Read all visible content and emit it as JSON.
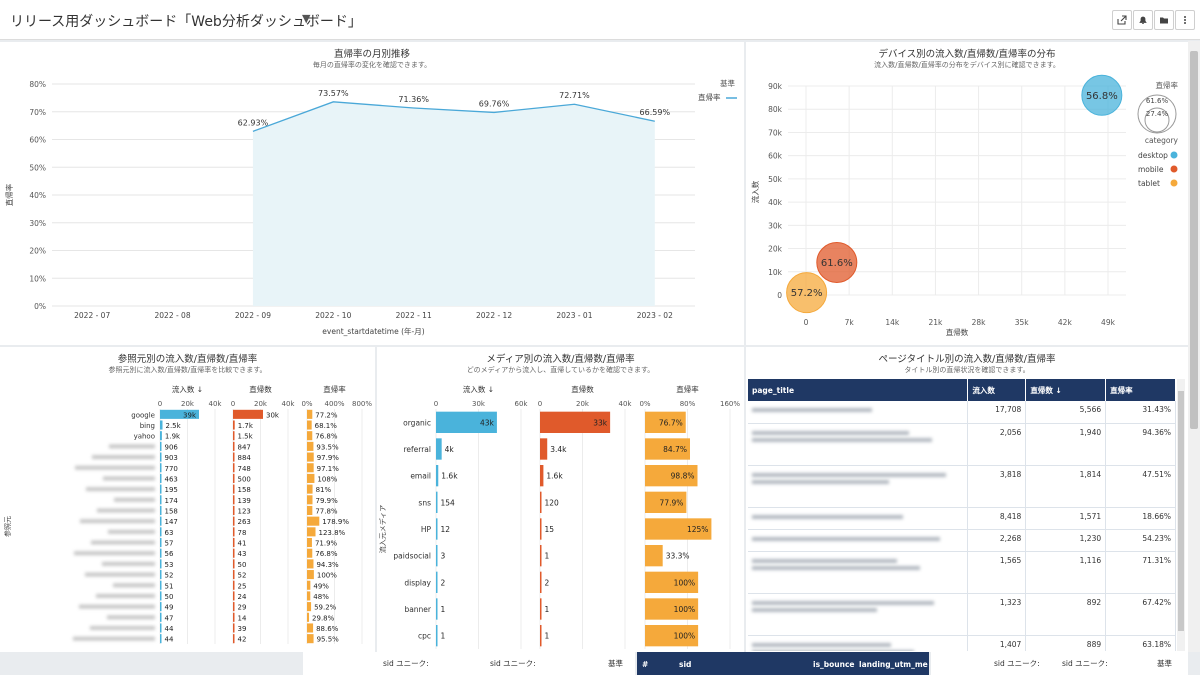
{
  "header": {
    "title": "リリース用ダッシュボード「Web分析ダッシュボード」",
    "caret": "▼",
    "icons": [
      "share-icon",
      "bell-icon",
      "folder-icon",
      "more-icon"
    ]
  },
  "p1": {
    "title": "直帰率の月別推移",
    "subtitle": "毎月の直帰率の変化を確認できます。",
    "ylabel": "直帰率",
    "xlabel": "event_startdatetime (年-月)",
    "legend_title": "基準",
    "legend_item": "直帰率",
    "chart_data": {
      "type": "area",
      "categories": [
        "2022 - 07",
        "2022 - 08",
        "2022 - 09",
        "2022 - 10",
        "2022 - 11",
        "2022 - 12",
        "2023 - 01",
        "2023 - 02"
      ],
      "values": [
        null,
        null,
        62.93,
        73.57,
        71.36,
        69.76,
        72.71,
        66.59
      ],
      "labels": [
        "",
        "",
        "62.93%",
        "73.57%",
        "71.36%",
        "69.76%",
        "72.71%",
        "66.59%"
      ],
      "yticks": [
        "80%",
        "70%",
        "60%",
        "50%",
        "40%",
        "30%",
        "20%",
        "10%",
        "0%"
      ],
      "ylim": [
        0,
        80
      ],
      "color": "#4aa8d8"
    }
  },
  "p2": {
    "title": "デバイス別の流入数/直帰数/直帰率の分布",
    "subtitle": "流入数/直帰数/直帰率の分布をデバイス別に確認できます。",
    "xlabel": "直帰数",
    "ylabel": "流入数",
    "size_legend_title": "直帰率",
    "size_legend": [
      "61.6%",
      "27.4%"
    ],
    "category_title": "category",
    "chart_data": {
      "type": "scatter",
      "xticks": [
        "0",
        "7k",
        "14k",
        "21k",
        "28k",
        "35k",
        "42k",
        "49k"
      ],
      "yticks": [
        "90k",
        "80k",
        "70k",
        "60k",
        "50k",
        "40k",
        "30k",
        "20k",
        "10k",
        "0"
      ],
      "xlim": [
        0,
        49000
      ],
      "ylim": [
        0,
        90000
      ],
      "series": [
        {
          "name": "desktop",
          "x": 48000,
          "y": 86000,
          "rate": "56.8%",
          "color": "#4ab3db"
        },
        {
          "name": "mobile",
          "x": 5000,
          "y": 14000,
          "rate": "61.6%",
          "color": "#e05a2b"
        },
        {
          "name": "tablet",
          "x": 100,
          "y": 1000,
          "rate": "57.2%",
          "color": "#f5a93b"
        }
      ]
    }
  },
  "p3": {
    "title": "参照元別の流入数/直帰数/直帰率",
    "subtitle": "参照元別に流入数/直帰数/直帰率を比較できます。",
    "ylabel": "参照元",
    "col_headers": [
      "流入数 ↓",
      "直帰数",
      "直帰率"
    ],
    "axes": [
      [
        "0",
        "20k",
        "40k"
      ],
      [
        "0",
        "20k",
        "40k"
      ],
      [
        "0%",
        "400%",
        "800%"
      ]
    ],
    "rows": [
      {
        "src": "google",
        "in": 39000,
        "in_l": "39k",
        "b": 30000,
        "b_l": "30k",
        "r": 77.2,
        "r_l": "77.2%"
      },
      {
        "src": "bing",
        "in": 2500,
        "in_l": "2.5k",
        "b": 1700,
        "b_l": "1.7k",
        "r": 68.1,
        "r_l": "68.1%"
      },
      {
        "src": "yahoo",
        "in": 1900,
        "in_l": "1.9k",
        "b": 1500,
        "b_l": "1.5k",
        "r": 76.8,
        "r_l": "76.8%"
      },
      {
        "src": "",
        "in": 906,
        "in_l": "906",
        "b": 847,
        "b_l": "847",
        "r": 93.5,
        "r_l": "93.5%"
      },
      {
        "src": "",
        "in": 903,
        "in_l": "903",
        "b": 884,
        "b_l": "884",
        "r": 97.9,
        "r_l": "97.9%"
      },
      {
        "src": "",
        "in": 770,
        "in_l": "770",
        "b": 748,
        "b_l": "748",
        "r": 97.1,
        "r_l": "97.1%"
      },
      {
        "src": "",
        "in": 463,
        "in_l": "463",
        "b": 500,
        "b_l": "500",
        "r": 108,
        "r_l": "108%"
      },
      {
        "src": "",
        "in": 195,
        "in_l": "195",
        "b": 158,
        "b_l": "158",
        "r": 81,
        "r_l": "81%"
      },
      {
        "src": "",
        "in": 174,
        "in_l": "174",
        "b": 139,
        "b_l": "139",
        "r": 79.9,
        "r_l": "79.9%"
      },
      {
        "src": "",
        "in": 158,
        "in_l": "158",
        "b": 123,
        "b_l": "123",
        "r": 77.8,
        "r_l": "77.8%"
      },
      {
        "src": "",
        "in": 147,
        "in_l": "147",
        "b": 263,
        "b_l": "263",
        "r": 178.9,
        "r_l": "178.9%"
      },
      {
        "src": "",
        "in": 63,
        "in_l": "63",
        "b": 78,
        "b_l": "78",
        "r": 123.8,
        "r_l": "123.8%"
      },
      {
        "src": "",
        "in": 57,
        "in_l": "57",
        "b": 41,
        "b_l": "41",
        "r": 71.9,
        "r_l": "71.9%"
      },
      {
        "src": "",
        "in": 56,
        "in_l": "56",
        "b": 43,
        "b_l": "43",
        "r": 76.8,
        "r_l": "76.8%"
      },
      {
        "src": "",
        "in": 53,
        "in_l": "53",
        "b": 50,
        "b_l": "50",
        "r": 94.3,
        "r_l": "94.3%"
      },
      {
        "src": "",
        "in": 52,
        "in_l": "52",
        "b": 52,
        "b_l": "52",
        "r": 100,
        "r_l": "100%"
      },
      {
        "src": "",
        "in": 51,
        "in_l": "51",
        "b": 25,
        "b_l": "25",
        "r": 49,
        "r_l": "49%"
      },
      {
        "src": "",
        "in": 50,
        "in_l": "50",
        "b": 24,
        "b_l": "24",
        "r": 48,
        "r_l": "48%"
      },
      {
        "src": "",
        "in": 49,
        "in_l": "49",
        "b": 29,
        "b_l": "29",
        "r": 59.2,
        "r_l": "59.2%"
      },
      {
        "src": "",
        "in": 47,
        "in_l": "47",
        "b": 14,
        "b_l": "14",
        "r": 29.8,
        "r_l": "29.8%"
      },
      {
        "src": "",
        "in": 44,
        "in_l": "44",
        "b": 39,
        "b_l": "39",
        "r": 88.6,
        "r_l": "88.6%"
      },
      {
        "src": "",
        "in": 44,
        "in_l": "44",
        "b": 42,
        "b_l": "42",
        "r": 95.5,
        "r_l": "95.5%"
      }
    ]
  },
  "p4": {
    "title": "メディア別の流入数/直帰数/直帰率",
    "subtitle": "どのメディアから流入し、直帰しているかを確認できます。",
    "ylabel": "流入元メディア",
    "col_headers": [
      "流入数 ↓",
      "直帰数",
      "直帰率"
    ],
    "axes": [
      [
        "0",
        "30k",
        "60k"
      ],
      [
        "0",
        "20k",
        "40k"
      ],
      [
        "0%",
        "80%",
        "160%"
      ]
    ],
    "rows": [
      {
        "src": "organic",
        "in": 43000,
        "in_l": "43k",
        "b": 33000,
        "b_l": "33k",
        "r": 76.7,
        "r_l": "76.7%"
      },
      {
        "src": "referral",
        "in": 4000,
        "in_l": "4k",
        "b": 3400,
        "b_l": "3.4k",
        "r": 84.7,
        "r_l": "84.7%"
      },
      {
        "src": "email",
        "in": 1600,
        "in_l": "1.6k",
        "b": 1600,
        "b_l": "1.6k",
        "r": 98.8,
        "r_l": "98.8%"
      },
      {
        "src": "sns",
        "in": 154,
        "in_l": "154",
        "b": 120,
        "b_l": "120",
        "r": 77.9,
        "r_l": "77.9%"
      },
      {
        "src": "HP",
        "in": 12,
        "in_l": "12",
        "b": 15,
        "b_l": "15",
        "r": 125,
        "r_l": "125%"
      },
      {
        "src": "paidsocial",
        "in": 3,
        "in_l": "3",
        "b": 1,
        "b_l": "1",
        "r": 33.3,
        "r_l": "33.3%"
      },
      {
        "src": "display",
        "in": 2,
        "in_l": "2",
        "b": 2,
        "b_l": "2",
        "r": 100,
        "r_l": "100%"
      },
      {
        "src": "banner",
        "in": 1,
        "in_l": "1",
        "b": 1,
        "b_l": "1",
        "r": 100,
        "r_l": "100%"
      },
      {
        "src": "cpc",
        "in": 1,
        "in_l": "1",
        "b": 1,
        "b_l": "1",
        "r": 100,
        "r_l": "100%"
      }
    ]
  },
  "p5": {
    "title": "ページタイトル別の流入数/直帰数/直帰率",
    "subtitle": "タイトル別の直帰状況を確認できます。",
    "headers": [
      "page_title",
      "流入数",
      "直帰数 ↓",
      "直帰率"
    ],
    "rows": [
      {
        "in": "17,708",
        "b": "5,566",
        "r": "31.43%"
      },
      {
        "in": "2,056",
        "b": "1,940",
        "r": "94.36%"
      },
      {
        "in": "3,818",
        "b": "1,814",
        "r": "47.51%"
      },
      {
        "in": "8,418",
        "b": "1,571",
        "r": "18.66%"
      },
      {
        "in": "2,268",
        "b": "1,230",
        "r": "54.23%"
      },
      {
        "in": "1,565",
        "b": "1,116",
        "r": "71.31%"
      },
      {
        "in": "1,323",
        "b": "892",
        "r": "67.42%"
      },
      {
        "in": "1,407",
        "b": "889",
        "r": "63.18%"
      }
    ]
  },
  "bottom": {
    "left1": "sid ユニーク:",
    "left2": "sid ユニーク:",
    "left3": "基準",
    "t1": "#",
    "t2": "sid",
    "t3": "is_bounce",
    "t4": "landing_utm_me",
    "right1": "sid ユニーク:",
    "right2": "sid ユニーク:",
    "right3": "基準"
  }
}
